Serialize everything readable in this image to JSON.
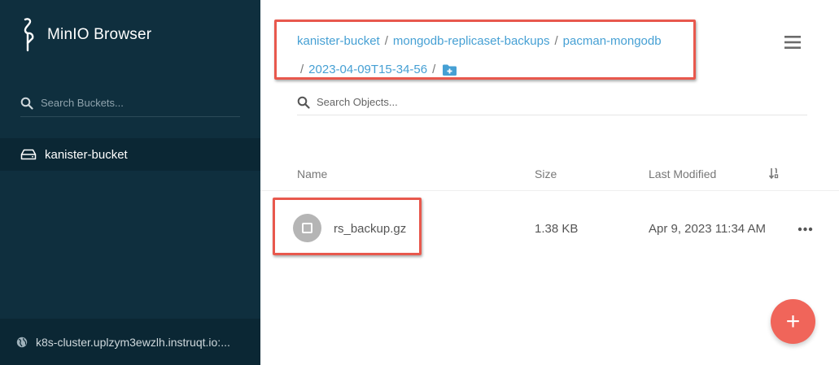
{
  "sidebar": {
    "brand": "MinIO Browser",
    "search_placeholder": "Search Buckets...",
    "buckets": [
      {
        "label": "kanister-bucket",
        "icon": "drive-icon"
      }
    ],
    "footer_host": "k8s-cluster.uplzym3ewzlh.instruqt.io:..."
  },
  "breadcrumb": {
    "items": [
      "kanister-bucket",
      "mongodb-replicaset-backups",
      "pacman-mongodb",
      "2023-04-09T15-34-56"
    ],
    "separator": "/"
  },
  "search": {
    "placeholder": "Search Objects..."
  },
  "table": {
    "columns": [
      "Name",
      "Size",
      "Last Modified"
    ],
    "rows": [
      {
        "name": "rs_backup.gz",
        "size": "1.38 KB",
        "modified": "Apr 9, 2023 11:34 AM"
      }
    ]
  },
  "fab": {
    "label": "+"
  },
  "colors": {
    "sidebar_bg": "#0f2f3e",
    "link": "#46a0d4",
    "highlight_border": "#e8584d",
    "fab": "#f0655a"
  }
}
